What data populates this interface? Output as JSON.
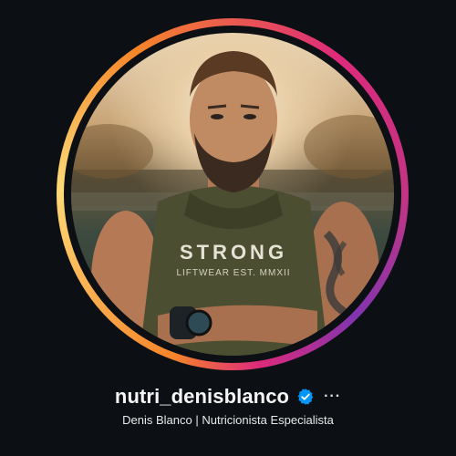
{
  "profile": {
    "username": "nutri_denisblanco",
    "full_name": "Denis Blanco | Nutricionista Especialista",
    "verified": true,
    "more_label": "···",
    "avatar": {
      "shirt_text_main": "STRONG",
      "shirt_text_sub": "LIFTWEAR EST. MMXII",
      "story_ring": true
    }
  },
  "colors": {
    "background": "#0c1014",
    "ring_orange": "#f58529",
    "ring_yellow": "#feda77",
    "ring_pink": "#dd2a7b",
    "ring_purple": "#8134af",
    "verified_blue": "#0095f6",
    "text": "#f5f5f5"
  },
  "icons": {
    "verified": "verified-badge-icon",
    "more": "more-options-icon"
  }
}
